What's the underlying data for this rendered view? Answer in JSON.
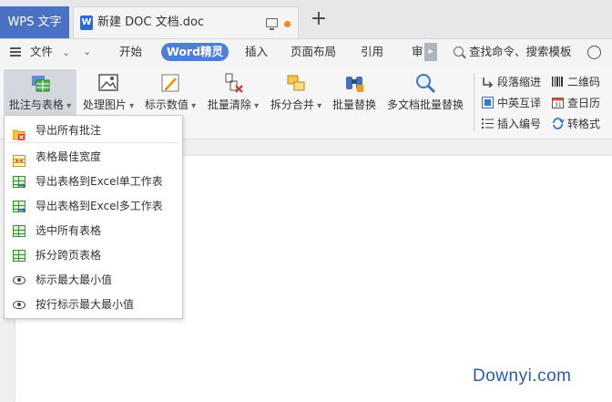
{
  "tabs": {
    "app_label": "WPS 文字",
    "doc_title": "新建 DOC 文档.doc",
    "new_tab_glyph": "+"
  },
  "menu": {
    "file_label": "文件",
    "items": [
      "开始",
      "Word精灵",
      "插入",
      "页面布局",
      "引用",
      "审"
    ],
    "active_item": "Word精灵",
    "search_placeholder": "查找命令、搜索模板"
  },
  "ribbon": {
    "buttons": [
      {
        "label": "批注与表格",
        "icon": "comment-table-icon",
        "has_caret": true
      },
      {
        "label": "处理图片",
        "icon": "picture-icon",
        "has_caret": true
      },
      {
        "label": "标示数值",
        "icon": "pen-icon",
        "has_caret": true
      },
      {
        "label": "批量清除",
        "icon": "eraser-icon",
        "has_caret": true
      },
      {
        "label": "拆分合并",
        "icon": "split-merge-icon",
        "has_caret": true
      },
      {
        "label": "批量替换",
        "icon": "binoculars-icon",
        "has_caret": false
      },
      {
        "label": "多文档批量替换",
        "icon": "magnifier-icon",
        "has_caret": false
      }
    ],
    "small_buttons": [
      {
        "label": "段落缩进",
        "icon": "indent-icon"
      },
      {
        "label": "二维码",
        "icon": "barcode-icon"
      },
      {
        "label": "中英互译",
        "icon": "translate-icon"
      },
      {
        "label": "查日历",
        "icon": "calendar-icon"
      },
      {
        "label": "插入编号",
        "icon": "numbering-icon"
      },
      {
        "label": "转格式",
        "icon": "convert-icon"
      }
    ]
  },
  "dropdown": {
    "items": [
      {
        "label": "导出所有批注",
        "icon": "folder-export-icon"
      },
      {
        "label": "表格最佳宽度",
        "icon": "table-width-icon"
      },
      {
        "label": "导出表格到Excel单工作表",
        "icon": "table-export-icon"
      },
      {
        "label": "导出表格到Excel多工作表",
        "icon": "table-export-icon"
      },
      {
        "label": "选中所有表格",
        "icon": "table-icon"
      },
      {
        "label": "拆分跨页表格",
        "icon": "table-icon"
      },
      {
        "label": "标示最大最小值",
        "icon": "eye-icon"
      },
      {
        "label": "按行标示最大最小值",
        "icon": "eye-icon"
      }
    ]
  },
  "watermark": "Downyi.com",
  "colors": {
    "accent": "#4c7fd5",
    "wps_tab": "#4a72c4",
    "modified_dot": "#f5861f"
  }
}
